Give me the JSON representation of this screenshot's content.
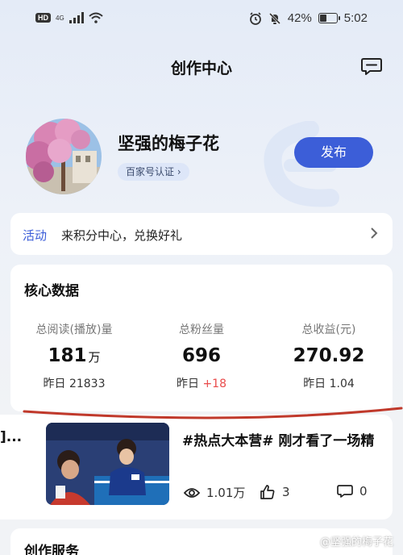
{
  "status_bar": {
    "hd": "HD",
    "network": "4G",
    "battery": "42%",
    "battery_level": 0.42,
    "time": "5:02",
    "icons": [
      "signal-icon",
      "wifi-icon",
      "alarm-icon",
      "mute-icon",
      "battery-icon"
    ]
  },
  "header": {
    "title": "创作中心",
    "message_icon": "chat-bubble-icon"
  },
  "profile": {
    "name": "坚强的梅子花",
    "verification": "百家号认证",
    "publish_label": "发布"
  },
  "activity": {
    "tag": "活动",
    "text": "来积分中心，兑换好礼"
  },
  "core_data": {
    "title": "核心数据",
    "stats": [
      {
        "label": "总阅读(播放)量",
        "value": "181",
        "unit": "万",
        "yesterday_label": "昨日",
        "yesterday_value": "21833"
      },
      {
        "label": "总粉丝量",
        "value": "696",
        "unit": "",
        "yesterday_label": "昨日",
        "yesterday_value": "+18"
      },
      {
        "label": "总收益(元)",
        "value": "270.92",
        "unit": "",
        "yesterday_label": "昨日",
        "yesterday_value": "1.04"
      }
    ]
  },
  "feed": {
    "left_clip": "]...",
    "title": "#热点大本营#  刚才看了一场精",
    "views": "1.01万",
    "likes": "3",
    "comments": "0"
  },
  "services": {
    "title": "创作服务"
  },
  "watermark": "@坚强的梅子花",
  "colors": {
    "accent": "#3c5ed8",
    "up": "#e94a4a",
    "annotation": "#c0392b"
  }
}
